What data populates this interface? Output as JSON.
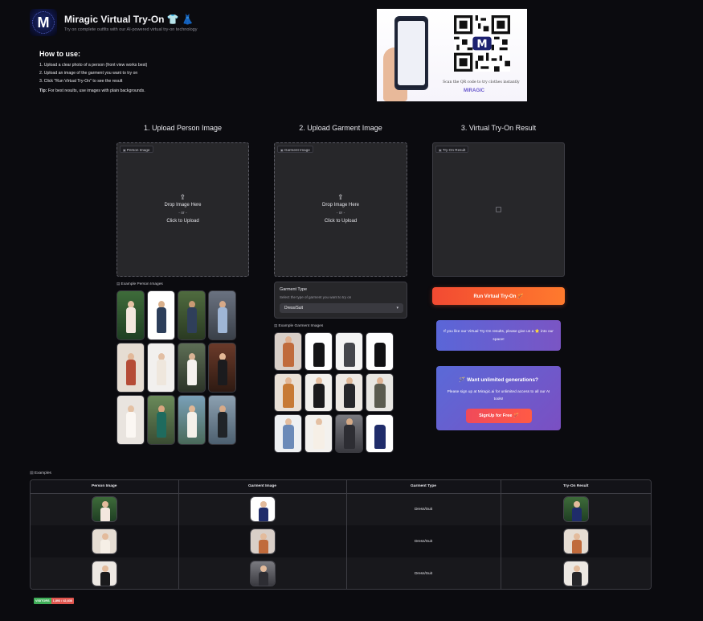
{
  "header": {
    "title": "Miragic Virtual Try-On 👕 👗",
    "subtitle": "Try on complete outfits with our AI-powered virtual try-on technology",
    "logo_letter": "M"
  },
  "how_to": {
    "title": "How to use:",
    "steps": [
      "1. Upload a clear photo of a person (front view works best)",
      "2. Upload an image of the garment you want to try on",
      "3. Click \"Run Virtual Try-On\" to see the result"
    ],
    "tip_label": "Tip:",
    "tip_text": " For best results, use images with plain backgrounds."
  },
  "promo": {
    "scan_text": "Scan the QR code to try clothes instantly",
    "brand": "MIRAGIC"
  },
  "columns": {
    "person_title": "1. Upload Person Image",
    "garment_title": "2. Upload Garment Image",
    "result_title": "3. Virtual Try-On Result"
  },
  "person_upload": {
    "tag": "Person Image",
    "drop_text": "Drop Image Here",
    "or_text": "- or -",
    "click_text": "Click to Upload"
  },
  "garment_upload": {
    "tag": "Garment Image",
    "drop_text": "Drop Image Here",
    "or_text": "- or -",
    "click_text": "Click to Upload"
  },
  "result_panel": {
    "tag": "Try-On Result"
  },
  "person_examples_label": "Example Person Images",
  "garment_examples_label": "Example Garment Images",
  "garment_type": {
    "title": "Garment Type",
    "description": "Select the type of garment you want to try on",
    "selected": "Dress/Suit"
  },
  "run_button": "Run Virtual Try-On 🪄",
  "info_star": "If you like our Virtual Try-On results, please give us a ⭐ into our space!",
  "promo_box": {
    "heading": "🪄 Want unlimited generations?",
    "text": "Please sign up at Miragic.ai for unlimited access to all our AI tools!",
    "button": "SignUp for Free 🪄"
  },
  "examples": {
    "label": "Examples",
    "headers": [
      "Person Image",
      "Garment Image",
      "Garment Type",
      "Try-On Result"
    ],
    "rows": [
      {
        "garment_type": "Dress/Suit"
      },
      {
        "garment_type": "Dress/Suit"
      },
      {
        "garment_type": "Dress/Suit"
      }
    ]
  },
  "visitors": {
    "label": "VISITORS",
    "count": "1,893 / 42,836"
  },
  "colors": {
    "background": "#0b0b0f",
    "panel": "#27272a",
    "run_button": "#ff6a2d",
    "info_box": "#6a5ad0"
  }
}
